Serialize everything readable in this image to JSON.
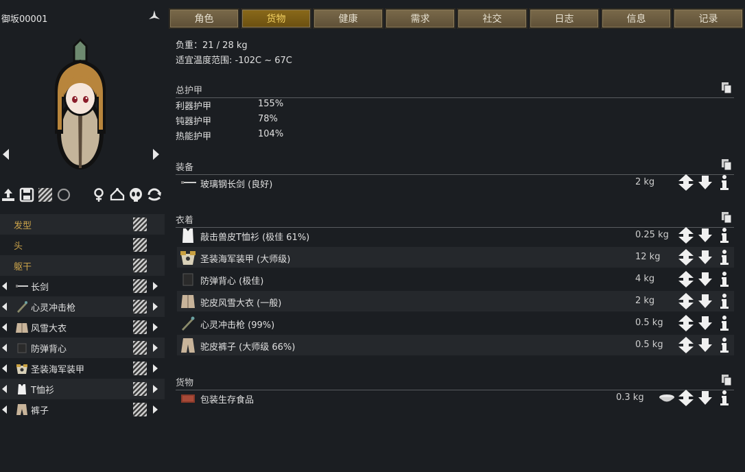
{
  "pawn": {
    "name": "御坂00001"
  },
  "tabs": [
    {
      "label": "角色",
      "active": false
    },
    {
      "label": "货物",
      "active": true
    },
    {
      "label": "健康",
      "active": false
    },
    {
      "label": "需求",
      "active": false
    },
    {
      "label": "社交",
      "active": false
    },
    {
      "label": "日志",
      "active": false
    },
    {
      "label": "信息",
      "active": false
    },
    {
      "label": "记录",
      "active": false
    }
  ],
  "summary": {
    "mass": "负重：21 / 28 kg",
    "comfy_temp": "适宜温度范围: -102C ~ 67C"
  },
  "armor": {
    "header": "总护甲",
    "stats": [
      {
        "name": "利器护甲",
        "value": "155%"
      },
      {
        "name": "钝器护甲",
        "value": "78%"
      },
      {
        "name": "热能护甲",
        "value": "104%"
      }
    ]
  },
  "equipment": {
    "header": "装备",
    "items": [
      {
        "label": "玻璃钢长剑 (良好)",
        "weight": "2 kg",
        "icon": "sword-icon"
      }
    ]
  },
  "apparel": {
    "header": "衣着",
    "items": [
      {
        "label": "敲击兽皮T恤衫 (极佳 61%)",
        "weight": "0.25 kg",
        "icon": "tshirt-icon"
      },
      {
        "label": "圣装海军装甲 (大师级)",
        "weight": "12 kg",
        "icon": "marine-armor-icon"
      },
      {
        "label": "防弹背心 (极佳)",
        "weight": "4 kg",
        "icon": "flak-vest-icon"
      },
      {
        "label": "驼皮风雪大衣 (一般)",
        "weight": "2 kg",
        "icon": "parka-icon"
      },
      {
        "label": "心灵冲击枪 (99%)",
        "weight": "0.5 kg",
        "icon": "psychic-lance-icon"
      },
      {
        "label": "驼皮裤子 (大师级 66%)",
        "weight": "0.5 kg",
        "icon": "pants-icon"
      }
    ]
  },
  "cargo": {
    "header": "货物",
    "items": [
      {
        "label": "包装生存食品",
        "weight": "0.3 kg",
        "icon": "survival-meal-icon"
      }
    ]
  },
  "slots": {
    "categories": [
      "发型",
      "头",
      "躯干"
    ],
    "items": [
      {
        "label": "长剑",
        "icon": "sword-icon"
      },
      {
        "label": "心灵冲击枪",
        "icon": "psychic-lance-icon"
      },
      {
        "label": "风雪大衣",
        "icon": "parka-icon"
      },
      {
        "label": "防弹背心",
        "icon": "flak-vest-icon"
      },
      {
        "label": "圣装海军装甲",
        "icon": "marine-armor-icon"
      },
      {
        "label": "T恤衫",
        "icon": "tshirt-icon"
      },
      {
        "label": "裤子",
        "icon": "pants-icon"
      }
    ]
  },
  "colors": {
    "background": "#1b1e22",
    "tab": "#6b5c40",
    "tab_active": "#7a5c14",
    "category_text": "#c9a24a"
  }
}
